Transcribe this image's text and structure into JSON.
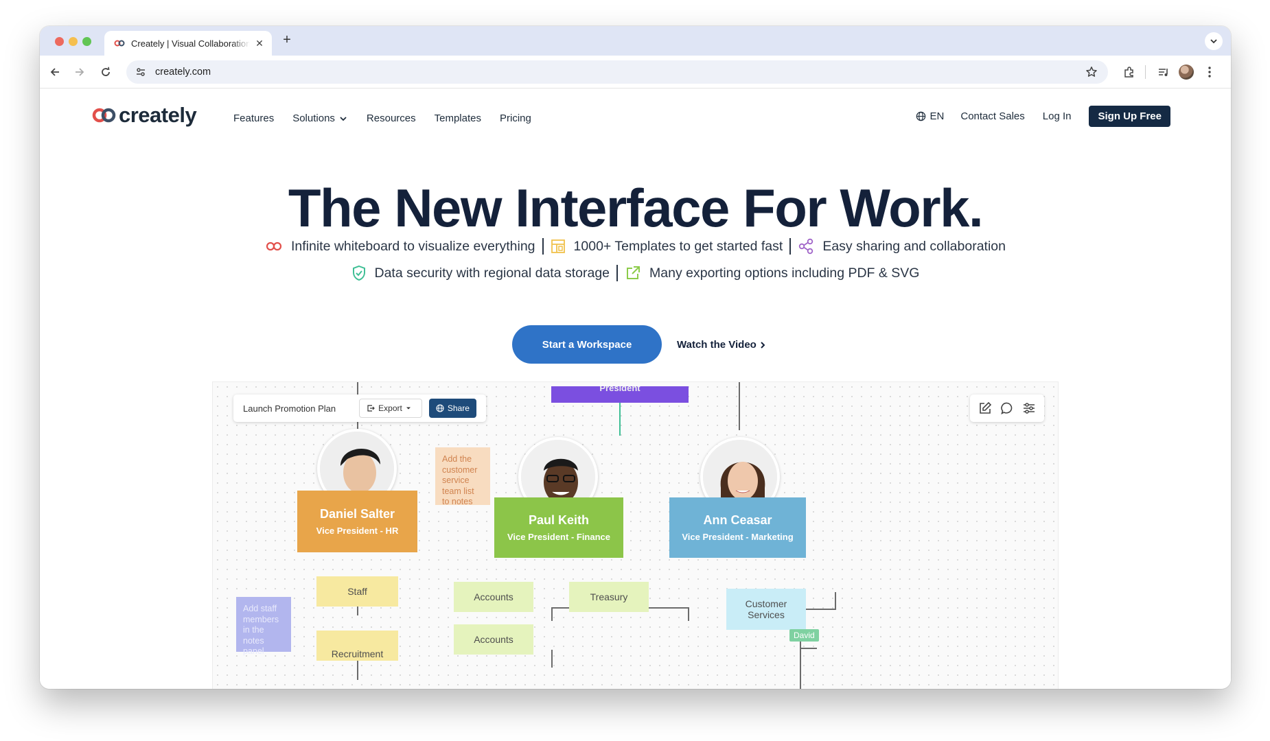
{
  "browser": {
    "tab_title": "Creately | Visual Collaboration",
    "url": "creately.com",
    "new_tab": "+",
    "close_tab": "✕"
  },
  "nav": {
    "logo_text": "creately",
    "items": [
      "Features",
      "Solutions",
      "Resources",
      "Templates",
      "Pricing"
    ],
    "language": "EN",
    "contact_sales": "Contact Sales",
    "log_in": "Log In",
    "sign_up": "Sign Up Free"
  },
  "hero": {
    "title": "The New Interface For Work.",
    "features_row1": [
      {
        "icon": "infinity-icon",
        "text": "Infinite whiteboard to visualize everything"
      },
      {
        "icon": "template-icon",
        "text": "1000+ Templates to get started fast"
      },
      {
        "icon": "share-icon",
        "text": "Easy sharing and collaboration"
      }
    ],
    "features_row2": [
      {
        "icon": "shield-icon",
        "text": "Data security with regional data storage"
      },
      {
        "icon": "export-icon",
        "text": "Many exporting options including PDF & SVG"
      }
    ],
    "cta_primary": "Start a Workspace",
    "cta_secondary": "Watch the Video"
  },
  "canvas": {
    "doc_name": "Launch Promotion Plan",
    "export_label": "Export",
    "share_label": "Share",
    "president_label": "President",
    "people": [
      {
        "name": "Daniel Salter",
        "role": "Vice President - HR"
      },
      {
        "name": "Paul Keith",
        "role": "Vice President - Finance"
      },
      {
        "name": "Ann Ceasar",
        "role": "Vice President - Marketing"
      }
    ],
    "notes": {
      "orange_note": "Add the customer service team list to notes",
      "purple_note": "Add staff members in the notes panel"
    },
    "boxes": {
      "staff": "Staff",
      "recruitment": "Recruitment",
      "accounts1": "Accounts",
      "accounts2": "Accounts",
      "treasury": "Treasury",
      "customer_services": "Customer Services"
    },
    "cursor_tag": "David"
  },
  "colors": {
    "brand_dark": "#14213a",
    "cta_blue": "#2f73c7",
    "signup_bg": "#152a44",
    "hr_orange": "#e8a54a",
    "finance_green": "#8cc549",
    "marketing_blue": "#6fb3d6",
    "president_purple": "#7b4fe0"
  }
}
